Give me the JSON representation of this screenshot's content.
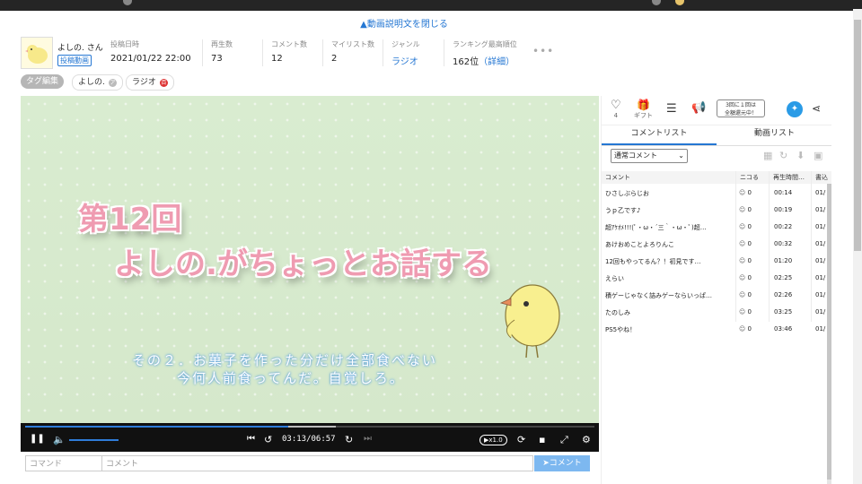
{
  "collapse_description": "▲動画説明文を閉じる",
  "owner": {
    "name": "よしの. さん",
    "badge": "投稿動画"
  },
  "stats": [
    {
      "label": "投稿日時",
      "value": "2021/01/22 22:00"
    },
    {
      "label": "再生数",
      "value": "73"
    },
    {
      "label": "コメント数",
      "value": "12"
    },
    {
      "label": "マイリスト数",
      "value": "2"
    },
    {
      "label": "ジャンル",
      "value": "ラジオ"
    },
    {
      "label": "ランキング最高順位",
      "value": "162位",
      "link": "（詳細）"
    }
  ],
  "more": "•••",
  "tags": {
    "edit": "タグ編集",
    "items": [
      "よしの.",
      "ラジオ"
    ],
    "ic1": "ア",
    "ic2": "百"
  },
  "video": {
    "title_line1": "第12回",
    "title_line2": "よしの.がちょっとお話する",
    "subtitle_line1": "その２．お菓子を作った分だけ全部食べない",
    "subtitle_line2": "今何人前食ってんだ。自覚しろ。"
  },
  "player": {
    "time": "03:13/06:57",
    "speed": "▶x1.0",
    "progress": 0.462,
    "buffered": 0.545,
    "volume": 0.55
  },
  "comment_form": {
    "command_placeholder": "コマンド",
    "comment_placeholder": "コメント",
    "send_label": "コメント"
  },
  "panel": {
    "like_count": "4",
    "gift_label": "ギフト",
    "ad_text_line1": "3回に１回は",
    "ad_text_line2": "全額還元中！",
    "tabs": [
      "コメントリスト",
      "動画リスト"
    ],
    "filter": "通常コメント",
    "columns": [
      "コメント",
      "ニコる",
      "再生時間",
      "書込"
    ],
    "comments": [
      {
        "text": "ひさしぶらじお",
        "nicoru": "0",
        "time": "00:14",
        "date": "01/"
      },
      {
        "text": "うｐ乙です♪",
        "nicoru": "0",
        "time": "00:19",
        "date": "01/"
      },
      {
        "text": "超ｱｹｵﾒ!!!(ﾟ・ω・´三｀・ω・ﾟ)超…",
        "nicoru": "0",
        "time": "00:22",
        "date": "01/"
      },
      {
        "text": "あけおめことよろりんこ",
        "nicoru": "0",
        "time": "00:32",
        "date": "01/"
      },
      {
        "text": "12回もやってるん？！初見です…",
        "nicoru": "0",
        "time": "01:20",
        "date": "01/"
      },
      {
        "text": "えらい",
        "nicoru": "0",
        "time": "02:25",
        "date": "01/"
      },
      {
        "text": "積ゲーじゃなく詰みゲーならいっぱ…",
        "nicoru": "0",
        "time": "02:26",
        "date": "01/"
      },
      {
        "text": "たのしみ",
        "nicoru": "0",
        "time": "03:25",
        "date": "01/"
      },
      {
        "text": "PS5やね！",
        "nicoru": "0",
        "time": "03:46",
        "date": "01/"
      }
    ]
  },
  "colors": {
    "accent": "#2577d3",
    "seek": "#2f7cd9",
    "pink": "#ef9bb1",
    "twitter": "#2a9be6"
  }
}
